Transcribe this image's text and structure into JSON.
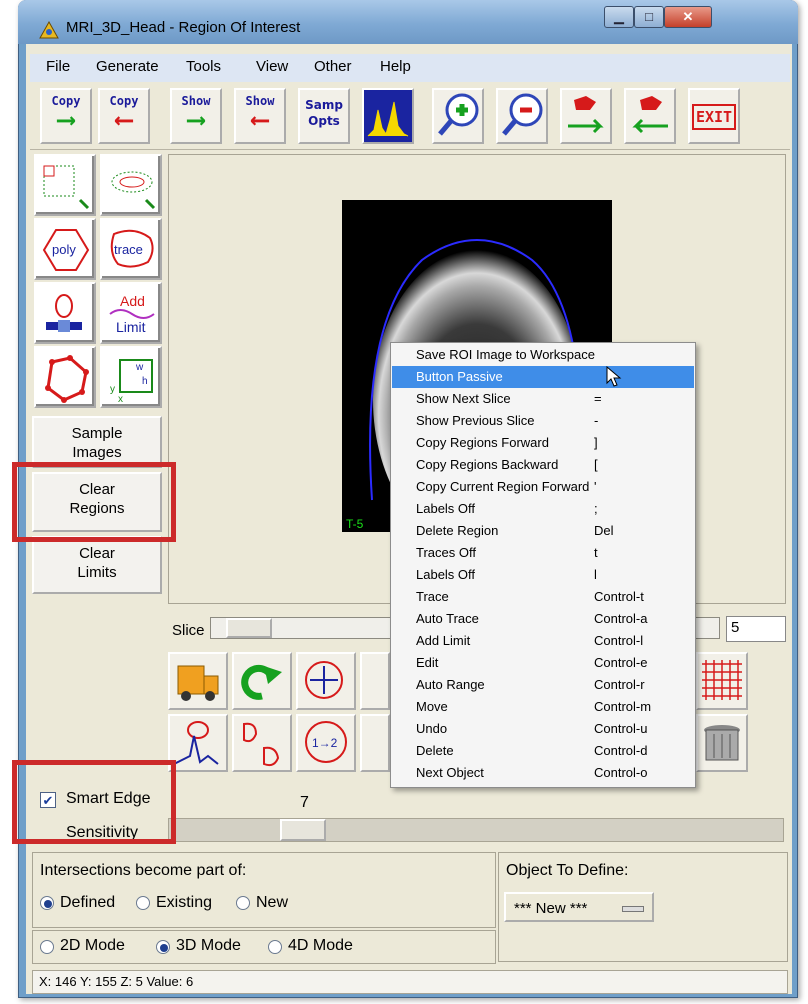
{
  "window": {
    "title": "MRI_3D_Head - Region Of Interest"
  },
  "menus": [
    "File",
    "Generate",
    "Tools",
    "View",
    "Other",
    "Help"
  ],
  "toolbar": {
    "copy_fwd": "Copy",
    "copy_back": "Copy",
    "show_fwd": "Show",
    "show_back": "Show",
    "samp_opts_1": "Samp",
    "samp_opts_2": "Opts",
    "exit": "EXIT"
  },
  "tools": {
    "poly": "poly",
    "trace": "trace",
    "add_1": "Add",
    "add_2": "Limit",
    "sample_1": "Sample",
    "sample_2": "Images",
    "clear_regions_1": "Clear",
    "clear_regions_2": "Regions",
    "clear_limits_1": "Clear",
    "clear_limits_2": "Limits"
  },
  "image": {
    "label": "T-5"
  },
  "slice": {
    "label": "Slice",
    "value": "5"
  },
  "context_menu": [
    {
      "name": "Save ROI Image to Workspace",
      "key": ""
    },
    {
      "name": "Button Passive",
      "key": "",
      "selected": true
    },
    {
      "name": "Show Next Slice",
      "key": "="
    },
    {
      "name": "Show Previous Slice",
      "key": "-"
    },
    {
      "name": "Copy Regions Forward",
      "key": "]"
    },
    {
      "name": "Copy Regions Backward",
      "key": "["
    },
    {
      "name": "Copy Current Region Forward",
      "key": "'"
    },
    {
      "name": "Labels Off",
      "key": ";"
    },
    {
      "name": "Delete Region",
      "key": "Del"
    },
    {
      "name": "Traces Off",
      "key": "t"
    },
    {
      "name": "Labels Off",
      "key": "l"
    },
    {
      "name": "Trace",
      "key": "Control-t"
    },
    {
      "name": "Auto Trace",
      "key": "Control-a"
    },
    {
      "name": "Add Limit",
      "key": "Control-l"
    },
    {
      "name": "Edit",
      "key": "Control-e"
    },
    {
      "name": "Auto Range",
      "key": "Control-r"
    },
    {
      "name": "Move",
      "key": "Control-m"
    },
    {
      "name": "Undo",
      "key": "Control-u"
    },
    {
      "name": "Delete",
      "key": "Control-d"
    },
    {
      "name": "Next Object",
      "key": "Control-o"
    }
  ],
  "smart_edge": {
    "label": "Smart Edge",
    "checked": true,
    "sensitivity_label": "Sensitivity",
    "sensitivity_value": "7"
  },
  "intersections": {
    "label": "Intersections become part of:",
    "options": [
      "Defined",
      "Existing",
      "New"
    ],
    "selected": "Defined"
  },
  "modes": {
    "options": [
      "2D Mode",
      "3D Mode",
      "4D Mode"
    ],
    "selected": "3D Mode"
  },
  "object": {
    "label": "Object To Define:",
    "value": "*** New ***"
  },
  "status": "X: 146 Y: 155 Z: 5 Value: 6",
  "colors": {
    "highlight": "#cc2a2a",
    "menu_select": "#3f8de8",
    "arrow_green": "#16a11f",
    "arrow_red": "#d61a1a"
  }
}
